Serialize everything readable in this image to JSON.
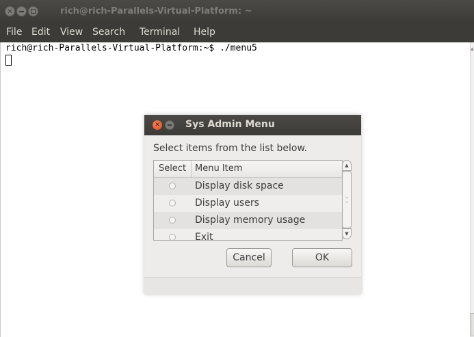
{
  "window": {
    "title": "rich@rich-Parallels-Virtual-Platform: ~",
    "close_glyph": "✕"
  },
  "menubar": {
    "items": [
      "File",
      "Edit",
      "View",
      "Search",
      "Terminal",
      "Help"
    ]
  },
  "terminal": {
    "prompt_line": "rich@rich-Parallels-Virtual-Platform:~$ ./menu5"
  },
  "dialog": {
    "title": "Sys Admin Menu",
    "close_glyph": "✕",
    "instruction": "Select items from the list below.",
    "columns": [
      "Select",
      "Menu Item"
    ],
    "rows": [
      {
        "label": "Display disk space"
      },
      {
        "label": "Display users"
      },
      {
        "label": "Display memory usage"
      },
      {
        "label": "Exit"
      }
    ],
    "cancel_label": "Cancel",
    "ok_label": "OK"
  },
  "icons": {
    "scroll_up": "▲",
    "scroll_down": "▼"
  },
  "colors": {
    "titlebar": "#3c3b37",
    "close_button_active": "#df4a16"
  }
}
